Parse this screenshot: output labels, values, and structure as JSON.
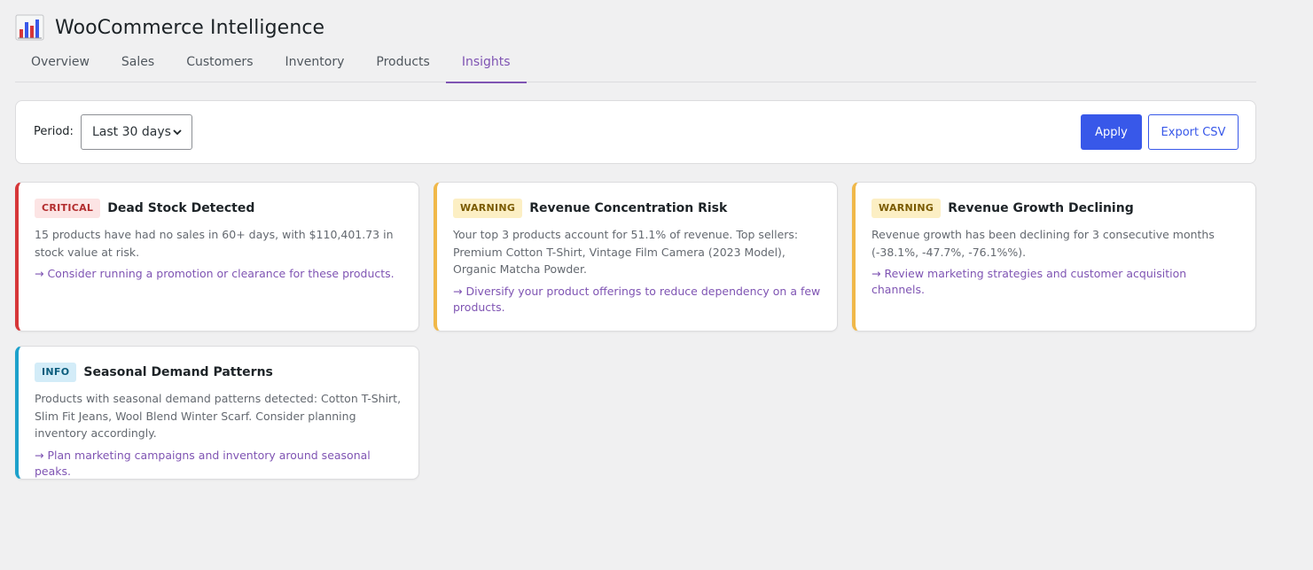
{
  "app": {
    "title": "WooCommerce Intelligence",
    "logo_icon": "bar-chart-icon"
  },
  "tabs": [
    {
      "label": "Overview",
      "active": false
    },
    {
      "label": "Sales",
      "active": false
    },
    {
      "label": "Customers",
      "active": false
    },
    {
      "label": "Inventory",
      "active": false
    },
    {
      "label": "Products",
      "active": false
    },
    {
      "label": "Insights",
      "active": true
    }
  ],
  "filters": {
    "period_label": "Period:",
    "period_value": "Last 30 days",
    "apply_label": "Apply",
    "export_label": "Export CSV"
  },
  "colors": {
    "accent": "#7f54b3",
    "primary_button": "#3858e9",
    "critical": "#d63638",
    "warning": "#f0b849",
    "info": "#1da1cb"
  },
  "insights": [
    {
      "severity": "critical",
      "badge": "CRITICAL",
      "title": "Dead Stock Detected",
      "description": "15 products have had no sales in 60+ days, with $110,401.73 in stock value at risk.",
      "action": "→ Consider running a promotion or clearance for these products."
    },
    {
      "severity": "warning",
      "badge": "WARNING",
      "title": "Revenue Concentration Risk",
      "description": "Your top 3 products account for 51.1% of revenue. Top sellers: Premium Cotton T-Shirt, Vintage Film Camera (2023 Model), Organic Matcha Powder.",
      "action": "→ Diversify your product offerings to reduce dependency on a few products."
    },
    {
      "severity": "warning",
      "badge": "WARNING",
      "title": "Revenue Growth Declining",
      "description": "Revenue growth has been declining for 3 consecutive months (-38.1%, -47.7%, -76.1%%).",
      "action": "→ Review marketing strategies and customer acquisition channels."
    },
    {
      "severity": "info",
      "badge": "INFO",
      "title": "Seasonal Demand Patterns",
      "description": "Products with seasonal demand patterns detected: Cotton T-Shirt, Slim Fit Jeans, Wool Blend Winter Scarf. Consider planning inventory accordingly.",
      "action": "→ Plan marketing campaigns and inventory around seasonal peaks."
    }
  ]
}
